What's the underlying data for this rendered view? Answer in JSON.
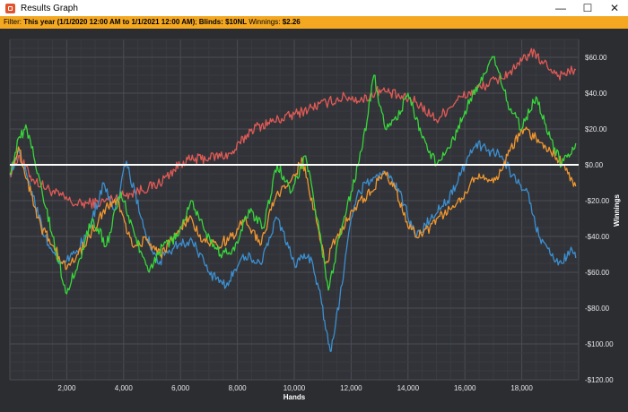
{
  "window": {
    "title": "Results Graph",
    "controls": {
      "minimize": "—",
      "maximize": "☐",
      "close": "✕"
    }
  },
  "filter": {
    "label": "Filter: ",
    "range": "This year (1/1/2020 12:00 AM to 1/1/2021 12:00 AM)",
    "blinds_label": "Blinds: ",
    "blinds": "$10NL",
    "winnings_label": "Winnings: ",
    "winnings": "$2.26"
  },
  "chart_data": {
    "type": "line",
    "xlabel": "Hands",
    "ylabel": "Winnings",
    "xlim": [
      0,
      20000
    ],
    "ylim": [
      -120,
      70
    ],
    "x_ticks": [
      2000,
      4000,
      6000,
      8000,
      10000,
      12000,
      14000,
      16000,
      18000
    ],
    "x_tick_labels": [
      "2,000",
      "4,000",
      "6,000",
      "8,000",
      "10,000",
      "12,000",
      "14,000",
      "16,000",
      "18,000"
    ],
    "y_ticks": [
      60,
      40,
      20,
      0,
      -20,
      -40,
      -60,
      -80,
      -100,
      -120
    ],
    "y_tick_labels": [
      "$60.00",
      "$40.00",
      "$20.00",
      "$0.00",
      "-$20.00",
      "-$40.00",
      "-$60.00",
      "-$80.00",
      "-$100.00",
      "-$120.00"
    ],
    "grid": true,
    "zero_line_color": "#ffffff",
    "series": [
      {
        "color": "#e05a56",
        "x": [
          0,
          300,
          800,
          1500,
          2300,
          3200,
          4200,
          5200,
          6100,
          7000,
          7800,
          8500,
          9200,
          10000,
          10600,
          11200,
          11800,
          12400,
          13000,
          13700,
          14300,
          15000,
          15700,
          16400,
          17200,
          17800,
          18300,
          18700,
          19300,
          19900
        ],
        "values": [
          -5,
          5,
          -8,
          -15,
          -22,
          -21,
          -16,
          -11,
          2,
          4,
          6,
          20,
          24,
          28,
          32,
          35,
          38,
          36,
          42,
          38,
          35,
          25,
          36,
          42,
          48,
          54,
          63,
          58,
          50,
          53
        ]
      },
      {
        "color": "#3c8fd0",
        "x": [
          0,
          300,
          700,
          1200,
          1800,
          2200,
          2700,
          3300,
          3700,
          4100,
          4700,
          5200,
          5800,
          6400,
          7000,
          7600,
          8200,
          8800,
          9400,
          10000,
          10500,
          10900,
          11100,
          11300,
          11600,
          12000,
          12300,
          12700,
          13200,
          13700,
          14300,
          14800,
          15400,
          16000,
          16400,
          16800,
          17300,
          17800,
          18200,
          18600,
          19000,
          19400,
          19700,
          19900
        ],
        "values": [
          -5,
          8,
          -10,
          -40,
          -55,
          -50,
          -40,
          -10,
          -25,
          2,
          -35,
          -55,
          -45,
          -42,
          -60,
          -68,
          -50,
          -55,
          -30,
          -55,
          -50,
          -70,
          -92,
          -104,
          -75,
          -30,
          -15,
          -8,
          -5,
          -15,
          -40,
          -30,
          -20,
          0,
          12,
          8,
          5,
          -10,
          -15,
          -40,
          -50,
          -55,
          -48,
          -52
        ]
      },
      {
        "color": "#f0962f",
        "x": [
          0,
          300,
          600,
          1100,
          1500,
          2000,
          2400,
          2800,
          3300,
          3800,
          4300,
          4800,
          5300,
          5800,
          6300,
          6800,
          7300,
          7800,
          8300,
          8800,
          9300,
          9800,
          10300,
          10700,
          11100,
          11500,
          11900,
          12300,
          12700,
          13100,
          13500,
          14000,
          14500,
          15000,
          15500,
          16000,
          16500,
          17000,
          17500,
          18000,
          18500,
          19000,
          19500,
          19900
        ],
        "values": [
          -5,
          10,
          -8,
          -35,
          -45,
          -58,
          -50,
          -40,
          -25,
          -20,
          -45,
          -42,
          -50,
          -40,
          -30,
          -42,
          -45,
          -40,
          -30,
          -45,
          -20,
          -10,
          2,
          -25,
          -55,
          -40,
          -30,
          -20,
          -15,
          -5,
          -10,
          -35,
          -40,
          -30,
          -25,
          -15,
          -5,
          -10,
          5,
          20,
          15,
          8,
          0,
          -12
        ]
      },
      {
        "color": "#37d63a",
        "x": [
          0,
          300,
          600,
          1000,
          1500,
          2000,
          2400,
          2900,
          3400,
          3900,
          4400,
          4900,
          5400,
          5900,
          6400,
          6900,
          7400,
          7900,
          8400,
          8900,
          9400,
          9900,
          10400,
          10800,
          11200,
          11600,
          12000,
          12400,
          12800,
          13200,
          13600,
          14000,
          14500,
          15000,
          15500,
          16000,
          16500,
          17000,
          17500,
          18000,
          18500,
          19000,
          19400,
          19900
        ],
        "values": [
          -5,
          15,
          20,
          -5,
          -40,
          -72,
          -55,
          -30,
          -45,
          -15,
          -40,
          -60,
          -45,
          -40,
          -20,
          -38,
          -50,
          -48,
          -25,
          -35,
          0,
          -15,
          5,
          -30,
          -70,
          -40,
          -15,
          10,
          50,
          20,
          25,
          40,
          15,
          0,
          10,
          30,
          45,
          60,
          35,
          20,
          38,
          15,
          0,
          12
        ]
      }
    ]
  }
}
